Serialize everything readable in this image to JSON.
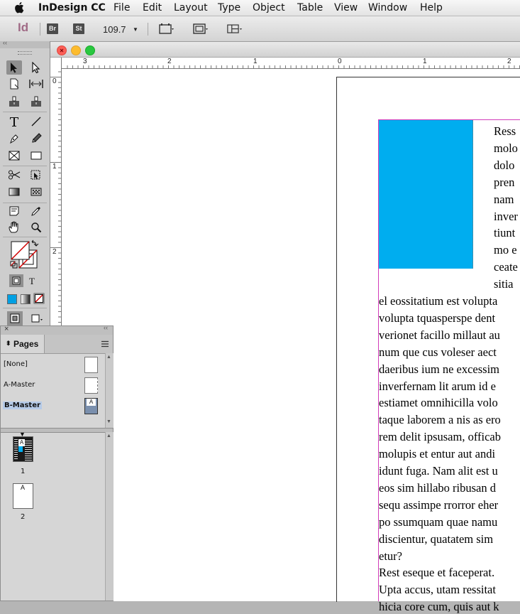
{
  "menubar": {
    "app_name": "InDesign CC",
    "items": [
      "File",
      "Edit",
      "Layout",
      "Type",
      "Object",
      "Table",
      "View",
      "Window",
      "Help"
    ]
  },
  "appbar": {
    "logo": "Id",
    "bridge_badge": "Br",
    "stock_badge": "St",
    "zoom": "109.7"
  },
  "toolbox": {
    "tools": [
      "selection-tool",
      "direct-selection-tool",
      "page-tool",
      "gap-tool",
      "content-collector-tool",
      "content-placer-tool",
      "type-tool",
      "line-tool",
      "pen-tool",
      "pencil-tool",
      "rectangle-frame-tool",
      "rectangle-tool",
      "scissors-tool",
      "free-transform-tool",
      "gradient-swatch-tool",
      "gradient-feather-tool",
      "note-tool",
      "eyedropper-tool",
      "hand-tool",
      "zoom-tool"
    ],
    "formatting_type_label": "T"
  },
  "rulers": {
    "horizontal": [
      "3",
      "2",
      "1",
      "0",
      "1",
      "2"
    ],
    "vertical": [
      "0",
      "1",
      "2"
    ]
  },
  "document": {
    "colors": {
      "frame_fill": "#00adef",
      "margin_guide": "#d23cb9"
    },
    "wrapped_lines": [
      "Ress",
      "molo",
      "dolo",
      "pren",
      "nam",
      "inver",
      "tiunt",
      "mo e",
      "ceate",
      "sitia"
    ],
    "full_lines": [
      "el eossitatium est volupta",
      "volupta tquasperspe dent",
      "verionet facillo millaut au",
      "num que cus voleser aect",
      "daeribus ium ne excessim",
      "inverfernam lit arum id e",
      "estiamet omnihicilla volo",
      "taque laborem a nis as ero",
      "rem delit ipsusam, officab",
      "molupis et entur aut andi",
      "idunt fuga. Nam alit est u",
      "eos sim hillabo ribusan d",
      "sequ assimpe rrorror eher",
      "po ssumquam quae namu",
      "discientur, quatatem sim",
      "etur?",
      "Rest eseque et faceperat.",
      "Upta accus, utam ressitat",
      "hicia core cum, quis aut k"
    ]
  },
  "pages_panel": {
    "tab_label": "Pages",
    "masters": [
      "[None]",
      "A-Master",
      "B-Master"
    ],
    "selected_master": "B-Master",
    "pages": [
      {
        "number": "1",
        "master_prefix": "A"
      },
      {
        "number": "2",
        "master_prefix": "A"
      }
    ]
  }
}
